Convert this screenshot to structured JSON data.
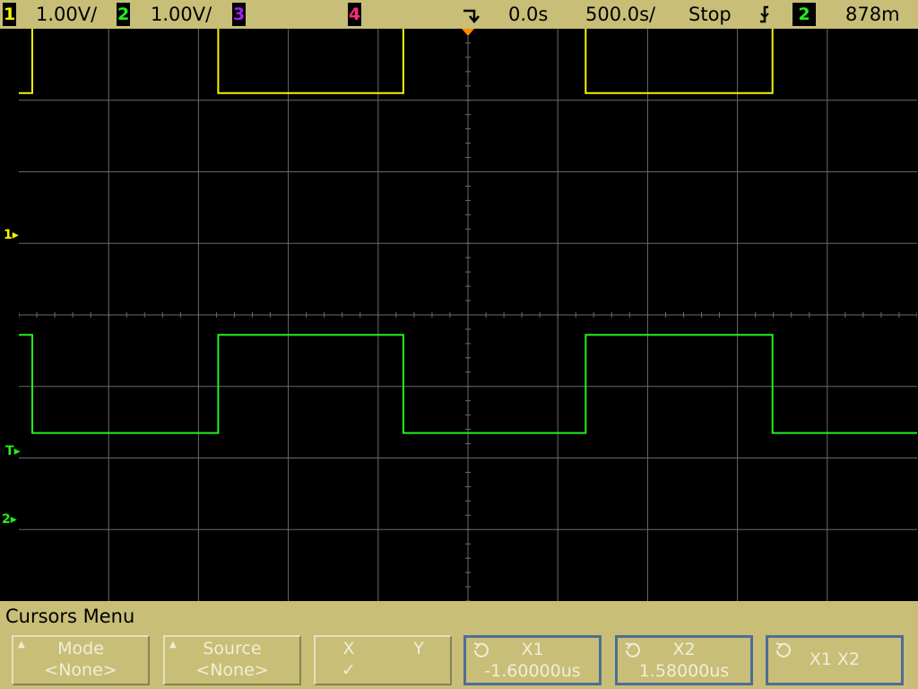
{
  "topbar": {
    "ch1": {
      "num": "1",
      "scale": "1.00V/",
      "color": "#f7f300"
    },
    "ch2": {
      "num": "2",
      "scale": "1.00V/",
      "color": "#22f01a"
    },
    "ch3": {
      "num": "3",
      "color": "#a020f0"
    },
    "ch4": {
      "num": "4",
      "color": "#ff2a7a"
    },
    "delay": "0.0s",
    "timebase": "500.0s/",
    "run_state": "Stop",
    "trigger_source": "2",
    "trigger_level": "878m"
  },
  "screen": {
    "ch1_marker": "1",
    "ch2_marker": "2",
    "trigger_marker": "T",
    "ch1_color": "#f7f300",
    "ch2_color": "#22f01a",
    "grid_color": "#6a6a6a",
    "trigger_pos_color": "#ff8c00"
  },
  "menu": {
    "title": "Cursors Menu",
    "softkeys": [
      {
        "line1": "Mode",
        "line2": "<None>"
      },
      {
        "line1": "Source",
        "line2": "<None>"
      },
      {
        "x": "X",
        "y": "Y",
        "check": "✓"
      },
      {
        "line1": "X1",
        "line2": "-1.60000us"
      },
      {
        "line1": "X2",
        "line2": "1.58000us"
      },
      {
        "line1": "X1 X2"
      }
    ]
  },
  "chart_data": {
    "type": "line",
    "xlabel": "",
    "ylabel": "",
    "grid": true,
    "x_divisions": 10,
    "y_divisions": 8,
    "series": [
      {
        "name": "1",
        "x": [
          -5,
          -4.85,
          -4.85,
          -2.78,
          -2.78,
          -0.72,
          -0.72,
          1.31,
          1.31,
          3.39,
          3.39,
          5
        ],
        "values": [
          3.1,
          3.1,
          4.55,
          4.55,
          3.1,
          3.1,
          4.55,
          4.55,
          3.1,
          3.1,
          4.55,
          4.55
        ]
      },
      {
        "name": "2",
        "x": [
          -5,
          -4.85,
          -4.85,
          -2.78,
          -2.78,
          -0.72,
          -0.72,
          1.31,
          1.31,
          3.39,
          3.39,
          5
        ],
        "values": [
          -0.28,
          -0.28,
          -1.65,
          -1.65,
          -0.28,
          -0.28,
          -1.65,
          -1.65,
          -0.28,
          -0.28,
          -1.65,
          -1.65
        ]
      }
    ]
  }
}
